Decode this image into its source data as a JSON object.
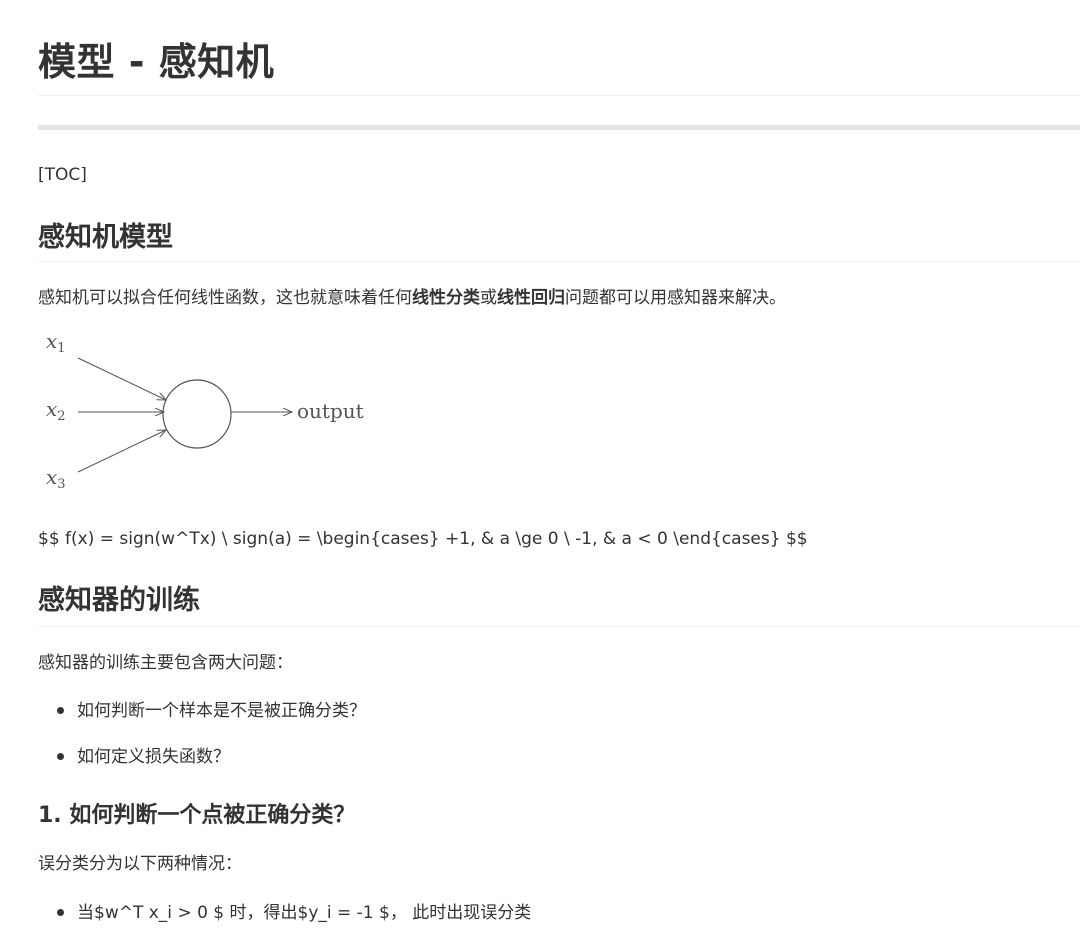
{
  "title": "模型 - 感知机",
  "toc": "[TOC]",
  "section1": {
    "heading": "感知机模型",
    "intro": {
      "before": "感知机可以拟合任何线性函数，这也就意味着任何",
      "bold1": "线性分类",
      "mid": "或",
      "bold2": "线性回归",
      "after": "问题都可以用感知器来解决。"
    },
    "diagram": {
      "inputs": [
        "x",
        "x",
        "x"
      ],
      "subscripts": [
        "1",
        "2",
        "3"
      ],
      "output_label": "output"
    },
    "formula": "$$ f(x) = sign(w^Tx) \\ sign(a) = \\begin{cases} +1, & a \\ge 0 \\ -1, & a < 0 \\end{cases} $$"
  },
  "section2": {
    "heading": "感知器的训练",
    "intro": "感知器的训练主要包含两大问题：",
    "bullets": [
      "如何判断一个样本是不是被正确分类？",
      "如何定义损失函数？"
    ]
  },
  "section3": {
    "heading": "1. 如何判断一个点被正确分类？",
    "intro": "误分类分为以下两种情况：",
    "bullets": [
      "当$w^T x_i > 0 $ 时，得出$y_i = -1 $， 此时出现误分类"
    ]
  },
  "colors": {
    "text": "#333333",
    "rule": "#eeeeee",
    "thick_rule": "#e3e5ea",
    "diagram_stroke": "#555555"
  }
}
